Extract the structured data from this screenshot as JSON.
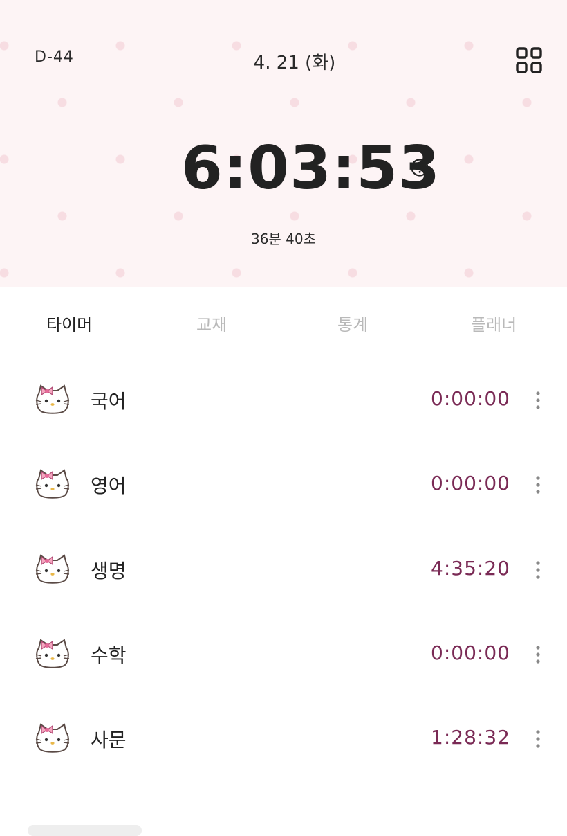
{
  "header": {
    "dday": "D-44",
    "date": "4. 21 (화)",
    "total_time": "6:03:53",
    "sub_time": "36분 40초",
    "menu_icon": "grid-icon",
    "help_icon": "question-circle-icon"
  },
  "tabs": [
    {
      "label": "타이머",
      "active": true
    },
    {
      "label": "교재",
      "active": false
    },
    {
      "label": "통계",
      "active": false
    },
    {
      "label": "플래너",
      "active": false
    }
  ],
  "subjects": [
    {
      "name": "국어",
      "time": "0:00:00",
      "icon": "hello-kitty-icon"
    },
    {
      "name": "영어",
      "time": "0:00:00",
      "icon": "hello-kitty-icon"
    },
    {
      "name": "생명",
      "time": "4:35:20",
      "icon": "hello-kitty-icon"
    },
    {
      "name": "수학",
      "time": "0:00:00",
      "icon": "hello-kitty-icon"
    },
    {
      "name": "사문",
      "time": "1:28:32",
      "icon": "hello-kitty-icon"
    }
  ],
  "colors": {
    "header_bg": "#fdf4f5",
    "dot": "#f7dde2",
    "time_accent": "#7a2a55",
    "inactive_tab": "#b9b9b9"
  }
}
